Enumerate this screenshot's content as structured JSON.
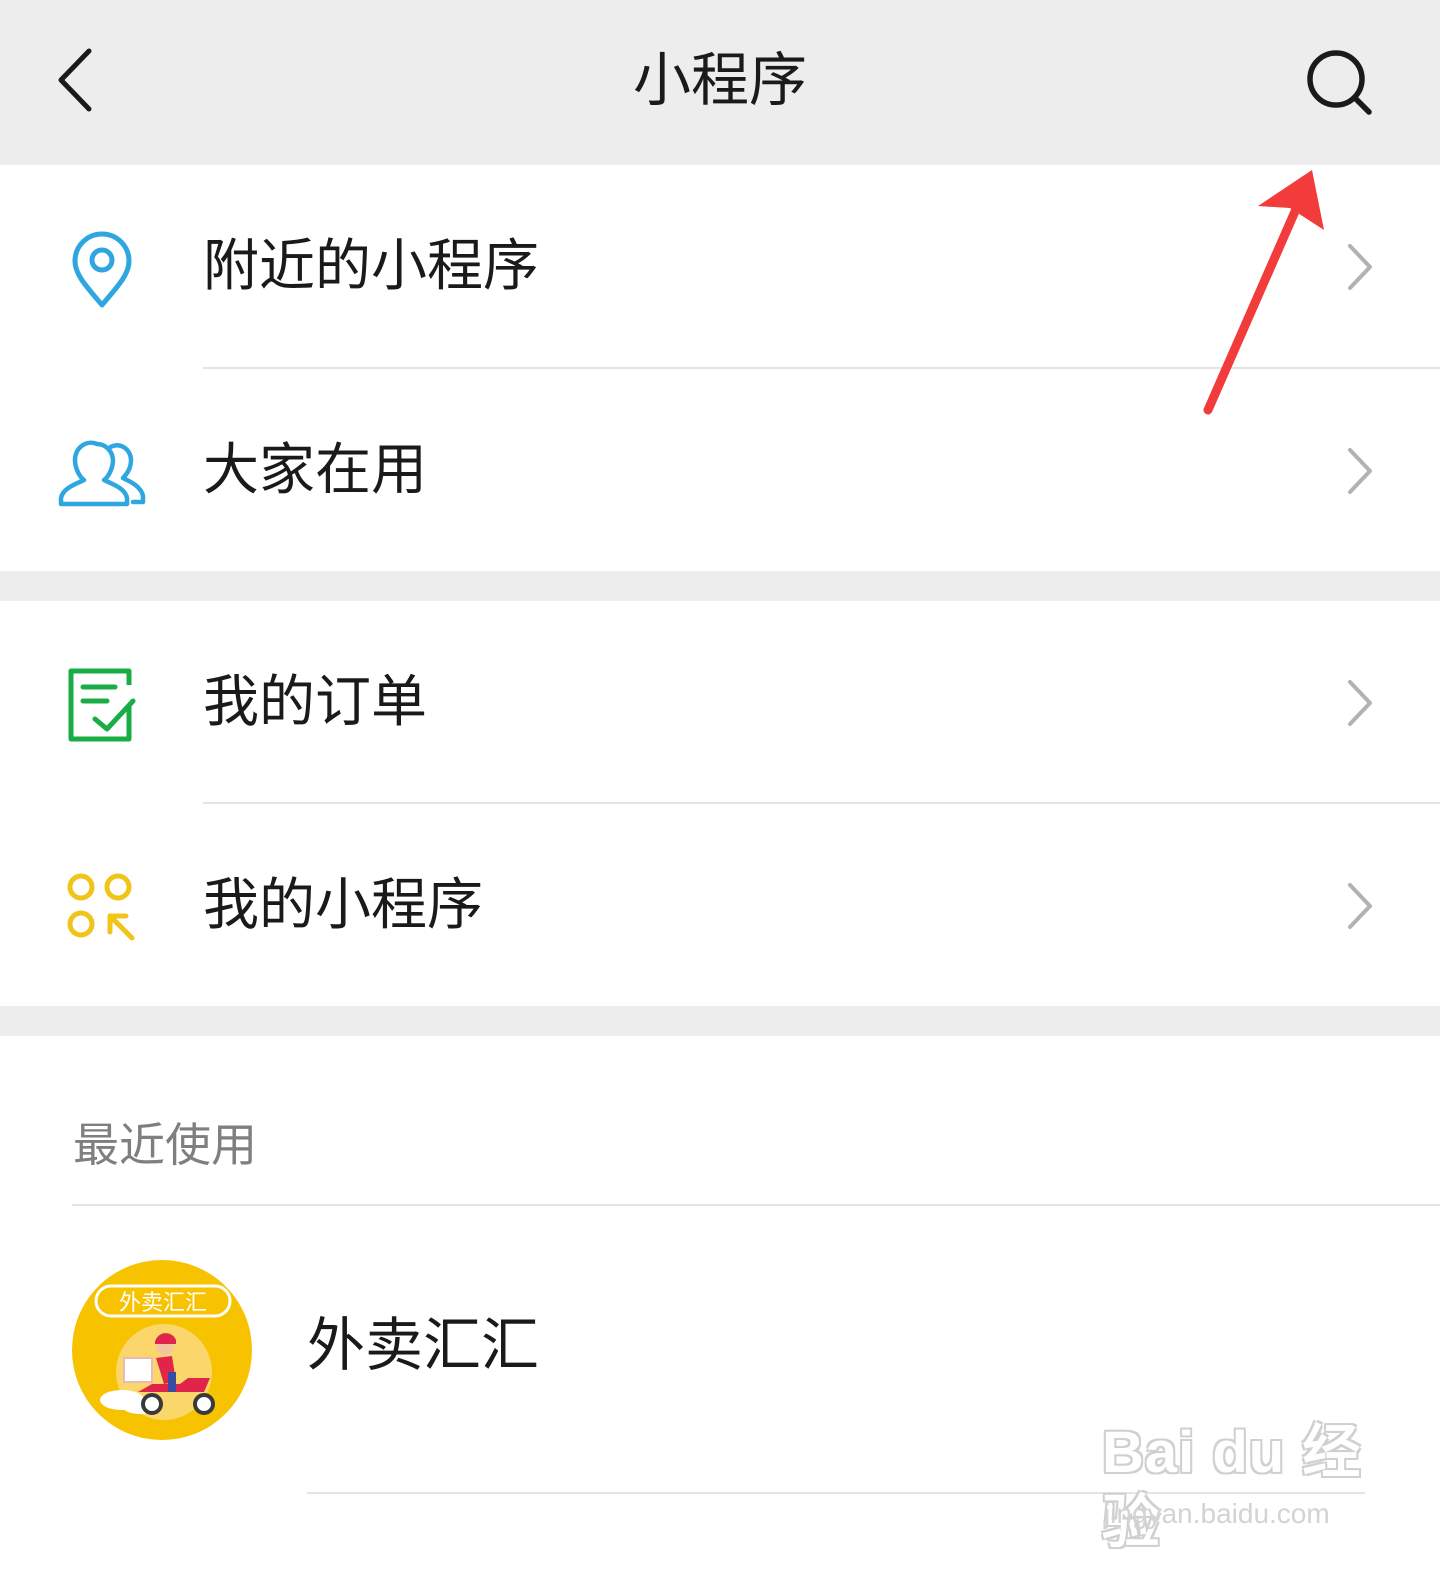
{
  "header": {
    "title": "小程序",
    "back_icon": "chevron-left-icon",
    "search_icon": "search-icon"
  },
  "menu_group_1": [
    {
      "label": "附近的小程序",
      "icon": "location-pin-icon",
      "icon_color": "#2ea7e0"
    },
    {
      "label": "大家在用",
      "icon": "users-icon",
      "icon_color": "#2ea7e0"
    }
  ],
  "menu_group_2": [
    {
      "label": "我的订单",
      "icon": "order-check-icon",
      "icon_color": "#1aad45"
    },
    {
      "label": "我的小程序",
      "icon": "my-miniprogram-icon",
      "icon_color": "#f0c419"
    }
  ],
  "recent": {
    "header": "最近使用",
    "items": [
      {
        "name": "外卖汇汇",
        "logo_text": "外卖汇汇",
        "logo_color": "#f7c200"
      }
    ]
  },
  "watermark": {
    "logo_text": "Bai du 经验",
    "url": "jingyan.baidu.com"
  },
  "colors": {
    "background_gray": "#ededed",
    "annotation_arrow": "#f23b3b"
  }
}
